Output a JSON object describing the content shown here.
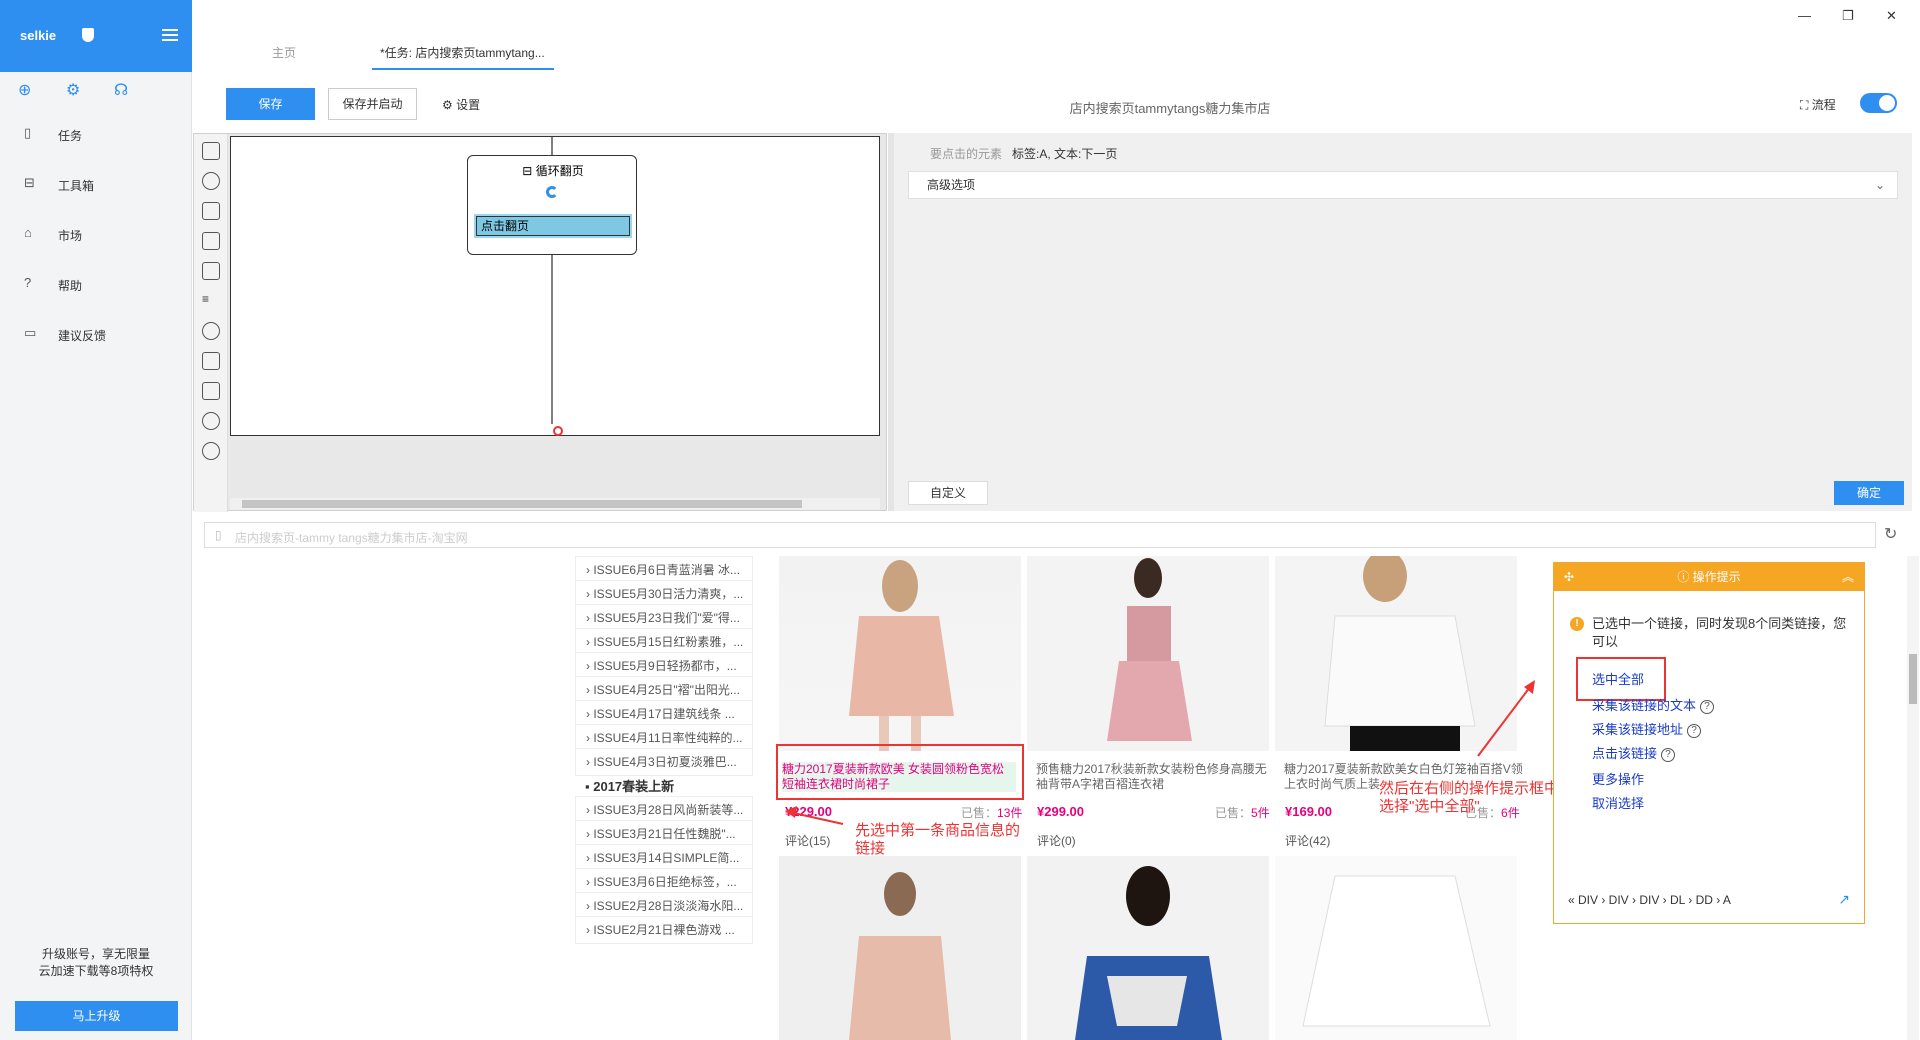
{
  "brand": "selkie",
  "sidebar": {
    "items": [
      {
        "label": "任务",
        "icon": "document-icon"
      },
      {
        "label": "工具箱",
        "icon": "toolbox-icon"
      },
      {
        "label": "市场",
        "icon": "shopping-bag-icon"
      },
      {
        "label": "帮助",
        "icon": "help-circle-icon"
      },
      {
        "label": "建议反馈",
        "icon": "feedback-icon"
      }
    ],
    "upgrade_line1": "升级账号，享无限量",
    "upgrade_line2": "云加速下载等8项特权",
    "upgrade_button": "马上升级"
  },
  "tabs": [
    {
      "label": "主页"
    },
    {
      "label": "*任务: 店内搜索页tammytang..."
    }
  ],
  "toolbar": {
    "save": "保存",
    "save_start": "保存并启动",
    "settings": "设置",
    "task_title": "店内搜索页tammytangs糖力集市店",
    "flow_label": "流程"
  },
  "designer": {
    "loop_title": "循环翻页",
    "click_node": "点击翻页"
  },
  "config": {
    "click_elem_key": "要点击的元素",
    "click_elem_val": "标签:A, 文本:下一页",
    "advanced": "高级选项",
    "custom": "自定义",
    "ok": "确定"
  },
  "url": "店内搜索页-tammy tangs糖力集市店-淘宝网",
  "categories": [
    "ISSUE6月6日青蓝消暑 冰...",
    "ISSUE5月30日活力清爽，...",
    "ISSUE5月23日我们\"爱\"得...",
    "ISSUE5月15日红粉素雅，...",
    "ISSUE5月9日轻扬都市，...",
    "ISSUE4月25日\"褶\"出阳光...",
    "ISSUE4月17日建筑线条 ...",
    "ISSUE4月11日率性纯粹的...",
    "ISSUE4月3日初夏淡雅巴...",
    "ISSUE3月28日风尚新装等...",
    "ISSUE3月21日任性魏脱\"...",
    "ISSUE3月14日SIMPLE简...",
    "ISSUE3月6日拒绝标签，...",
    "ISSUE2月28日淡淡海水阳...",
    "ISSUE2月21日裸色游戏 ..."
  ],
  "category_head": "2017春装上新",
  "products": [
    {
      "title": "糖力2017夏装新款欧美 女装圆领粉色宽松短袖连衣裙时尚裙子",
      "price": "¥229.00",
      "sold_label": "已售：",
      "sold": "13件",
      "review": "评论(15)"
    },
    {
      "title": "预售糖力2017秋装新款女装粉色修身高腰无袖背带A字裙百褶连衣裙",
      "price": "¥299.00",
      "sold_label": "已售：",
      "sold": "5件",
      "review": "评论(0)"
    },
    {
      "title": "糖力2017夏装新款欧美女白色灯笼袖百搭V领上衣时尚气质上装",
      "price": "¥169.00",
      "sold_label": "已售：",
      "sold": "6件",
      "review": "评论(42)"
    }
  ],
  "annotations": {
    "first": "先选中第一条商品信息的链接",
    "second": "然后在右侧的操作提示框中，选择\"选中全部\""
  },
  "tip": {
    "title": "操作提示",
    "message": "已选中一个链接，同时发现8个同类链接，您可以",
    "select_all": "选中全部",
    "collect_text": "采集该链接的文本",
    "collect_url": "采集该链接地址",
    "click_link": "点击该链接",
    "more": "更多操作",
    "cancel": "取消选择",
    "crumbs": "«  DIV  ›  DIV  ›  DIV  ›  DL  ›  DD  ›  A"
  },
  "colors": {
    "accent": "#2f8ff0",
    "tip_header": "#f5a623",
    "annotation": "#e33333",
    "price": "#e4007f"
  }
}
